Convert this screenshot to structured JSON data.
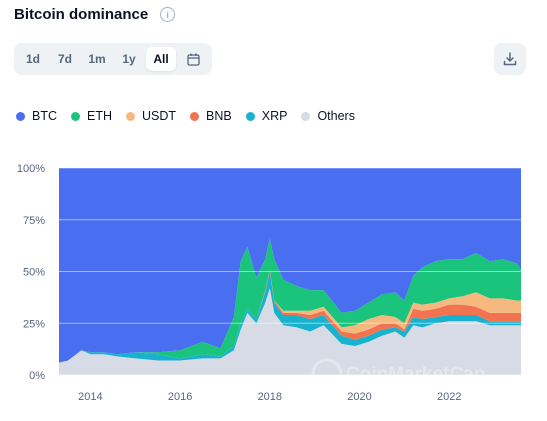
{
  "header": {
    "title": "Bitcoin dominance",
    "info_icon": "info-icon"
  },
  "range_buttons": [
    "1d",
    "7d",
    "1m",
    "1y",
    "All"
  ],
  "active_range": "All",
  "calendar_icon": "calendar-icon",
  "download_icon": "download-icon",
  "watermark": "CoinMarketCap",
  "colors": {
    "BTC": "#4a6ef0",
    "ETH": "#1bc47d",
    "USDT": "#f5b97f",
    "BNB": "#f2734f",
    "XRP": "#19b2ce",
    "Others": "#d6dbe5"
  },
  "chart_data": {
    "type": "area",
    "stacked": true,
    "stacking": "percent",
    "title": "Bitcoin dominance",
    "xlabel": "",
    "ylabel": "",
    "ylim": [
      0,
      100
    ],
    "yticks": [
      "0%",
      "25%",
      "50%",
      "75%",
      "100%"
    ],
    "xticks": [
      "2014",
      "2016",
      "2018",
      "2020",
      "2022"
    ],
    "x": [
      2013.3,
      2013.5,
      2013.8,
      2014.0,
      2014.3,
      2014.6,
      2015.0,
      2015.5,
      2016.0,
      2016.5,
      2016.9,
      2017.2,
      2017.35,
      2017.5,
      2017.7,
      2017.9,
      2018.0,
      2018.1,
      2018.3,
      2018.6,
      2018.9,
      2019.2,
      2019.6,
      2019.9,
      2020.2,
      2020.5,
      2020.8,
      2021.0,
      2021.2,
      2021.4,
      2021.7,
      2022.0,
      2022.3,
      2022.6,
      2022.9,
      2023.2,
      2023.5,
      2023.6
    ],
    "series": [
      {
        "name": "Others",
        "values": [
          6,
          7,
          12,
          10,
          10,
          9,
          8,
          7,
          7,
          8,
          8,
          12,
          22,
          30,
          25,
          35,
          42,
          30,
          24,
          23,
          21,
          24,
          15,
          14,
          16,
          19,
          21,
          18,
          24,
          23,
          25,
          26,
          26,
          26,
          24,
          24,
          24,
          24
        ]
      },
      {
        "name": "XRP",
        "values": [
          0,
          0,
          0,
          1,
          1,
          1,
          3,
          3,
          1,
          2,
          1,
          2,
          3,
          2,
          2,
          5,
          8,
          5,
          5,
          6,
          6,
          5,
          4,
          3,
          3,
          3,
          2,
          3,
          4,
          4,
          3,
          3,
          3,
          3,
          2,
          2,
          2,
          2
        ]
      },
      {
        "name": "BNB",
        "values": [
          0,
          0,
          0,
          0,
          0,
          0,
          0,
          0,
          0,
          0,
          0,
          0,
          0,
          0,
          0,
          1,
          1,
          1,
          1,
          1,
          2,
          2,
          2,
          3,
          3,
          3,
          2,
          1,
          4,
          4,
          4,
          5,
          5,
          4,
          4,
          4,
          4,
          4
        ]
      },
      {
        "name": "USDT",
        "values": [
          0,
          0,
          0,
          0,
          0,
          0,
          0,
          0,
          0,
          0,
          0,
          0,
          0,
          0,
          0,
          0,
          0,
          0,
          1,
          1,
          2,
          2,
          2,
          4,
          5,
          4,
          3,
          3,
          3,
          3,
          3,
          3,
          4,
          7,
          7,
          7,
          6,
          6
        ]
      },
      {
        "name": "ETH",
        "values": [
          0,
          0,
          0,
          0,
          0,
          0,
          0,
          1,
          4,
          6,
          4,
          14,
          30,
          30,
          20,
          15,
          15,
          20,
          15,
          12,
          10,
          8,
          7,
          7,
          8,
          10,
          12,
          11,
          13,
          18,
          20,
          19,
          18,
          19,
          18,
          19,
          18,
          15
        ]
      },
      {
        "name": "BTC",
        "values": [
          94,
          93,
          88,
          89,
          89,
          90,
          89,
          89,
          88,
          84,
          87,
          72,
          45,
          38,
          53,
          44,
          34,
          44,
          54,
          57,
          59,
          59,
          70,
          69,
          65,
          61,
          60,
          64,
          52,
          48,
          45,
          44,
          44,
          41,
          45,
          44,
          46,
          49
        ]
      }
    ]
  }
}
